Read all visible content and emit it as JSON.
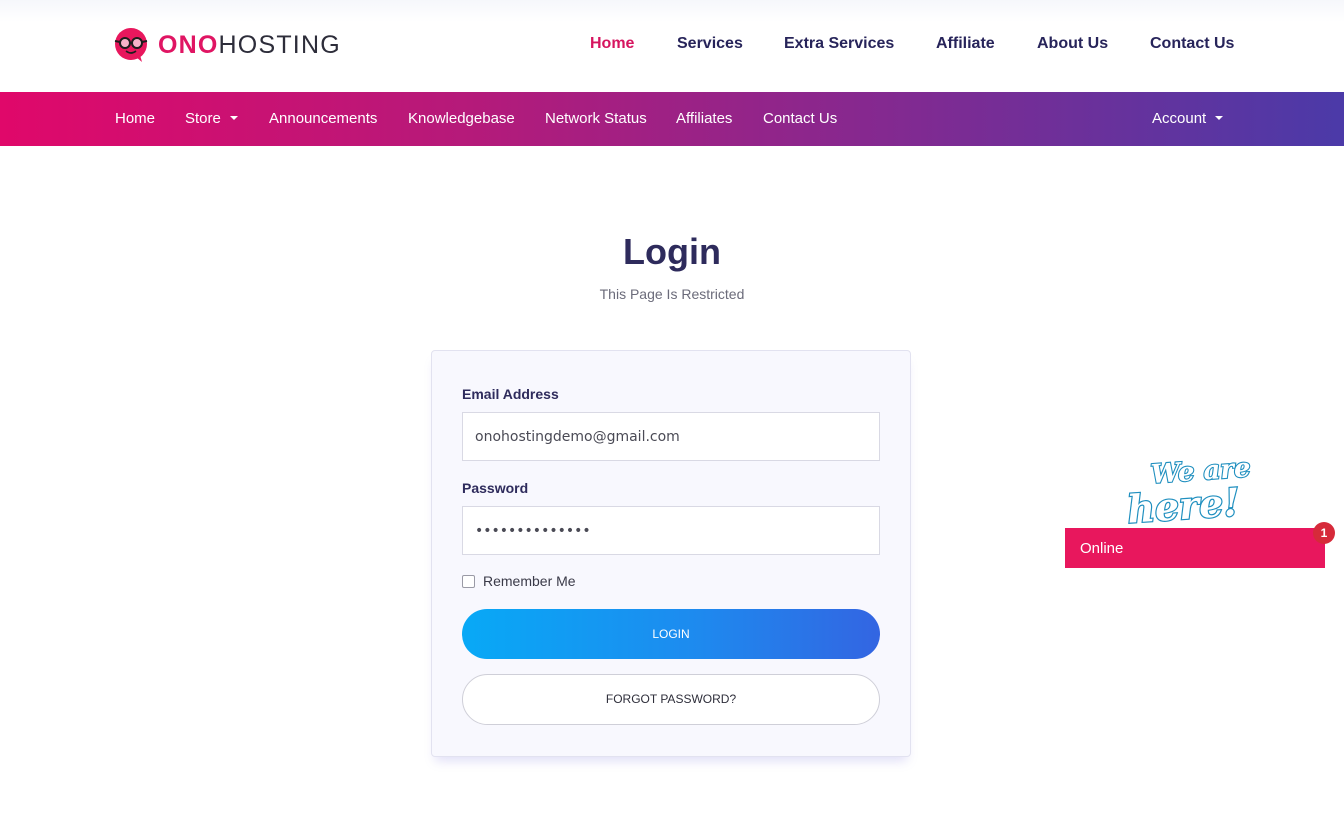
{
  "brand": {
    "name_part1": "ONO",
    "name_part2": "HOSTING",
    "color": "#e01563"
  },
  "main_nav": [
    {
      "label": "Home",
      "active": true
    },
    {
      "label": "Services"
    },
    {
      "label": "Extra Services"
    },
    {
      "label": "Affiliate"
    },
    {
      "label": "About Us"
    },
    {
      "label": "Contact Us"
    }
  ],
  "sub_nav": {
    "items": [
      {
        "label": "Home"
      },
      {
        "label": "Store",
        "dropdown": true
      },
      {
        "label": "Announcements"
      },
      {
        "label": "Knowledgebase"
      },
      {
        "label": "Network Status"
      },
      {
        "label": "Affiliates"
      },
      {
        "label": "Contact Us"
      }
    ],
    "account": {
      "label": "Account",
      "dropdown": true
    }
  },
  "page": {
    "title": "Login",
    "subtitle": "This Page Is Restricted"
  },
  "form": {
    "email_label": "Email Address",
    "email_value": "onohostingdemo@gmail.com",
    "password_label": "Password",
    "password_value": "••••••••••••••",
    "remember_label": "Remember Me",
    "remember_checked": false,
    "login_button": "LOGIN",
    "forgot_button": "FORGOT PASSWORD?"
  },
  "chat": {
    "art_text_line1": "We are",
    "art_text_line2": "here!",
    "status": "Online",
    "badge_count": "1"
  },
  "colors": {
    "accent": "#e01563",
    "nav_text": "#27245a",
    "gradient_start": "#e0086a",
    "gradient_end": "#4b3aa8",
    "login_button_start": "#08a9f6",
    "login_button_end": "#3365e2"
  }
}
